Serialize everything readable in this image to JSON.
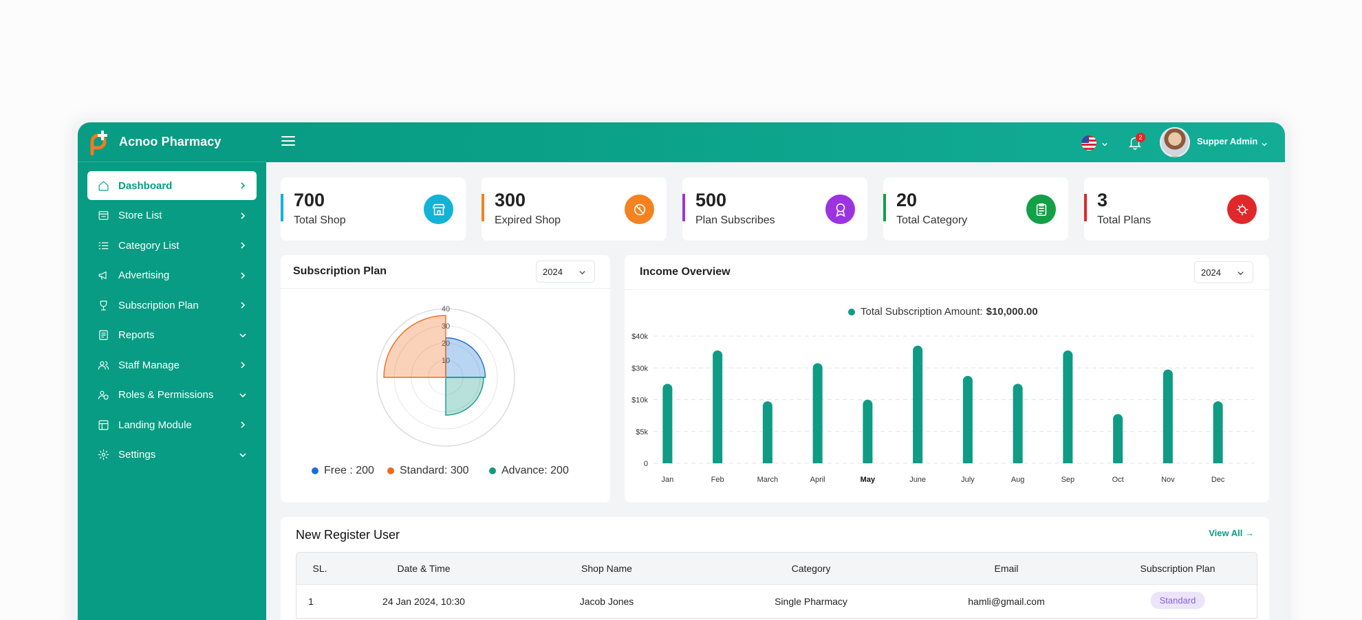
{
  "app": {
    "brand": "Acnoo Pharmacy"
  },
  "sidebar": {
    "items": [
      {
        "label": "Dashboard"
      },
      {
        "label": "Store List"
      },
      {
        "label": "Category List"
      },
      {
        "label": "Advertising"
      },
      {
        "label": "Subscription Plan"
      },
      {
        "label": "Reports"
      },
      {
        "label": "Staff Manage"
      },
      {
        "label": "Roles & Permissions"
      },
      {
        "label": "Landing Module"
      },
      {
        "label": "Settings"
      }
    ]
  },
  "topbar": {
    "notification_count": "2",
    "user_name": "Supper Admin"
  },
  "stats": [
    {
      "value": "700",
      "label": "Total Shop",
      "color": "#12b3d6"
    },
    {
      "value": "300",
      "label": "Expired Shop",
      "color": "#f58220"
    },
    {
      "value": "500",
      "label": "Plan Subscribes",
      "color": "#9b34e0"
    },
    {
      "value": "20",
      "label": "Total Category",
      "color": "#13a047"
    },
    {
      "value": "3",
      "label": "Total Plans",
      "color": "#e0282a"
    }
  ],
  "subscription_panel": {
    "title": "Subscription Plan",
    "year": "2024",
    "legend": [
      {
        "text": "Free : 200",
        "color": "#1a6fd6"
      },
      {
        "text": "Standard: 300",
        "color": "#f06a1a"
      },
      {
        "text": "Advance: 200",
        "color": "#0f9b84"
      }
    ]
  },
  "income_panel": {
    "title": "Income Overview",
    "year": "2024",
    "legend_label": "Total Subscription Amount:",
    "legend_value": "$10,000.00"
  },
  "chart_data": [
    {
      "type": "polar-area",
      "radial_ticks": [
        "10",
        "20",
        "30",
        "40"
      ],
      "rmax": 40,
      "categories": [
        "Free",
        "Standard",
        "Advance"
      ],
      "values": [
        23,
        36,
        22
      ],
      "colors": [
        "#1a6fd6",
        "#f06a1a",
        "#0f9b84"
      ]
    },
    {
      "type": "bar",
      "categories": [
        "Jan",
        "Feb",
        "March",
        "April",
        "May",
        "June",
        "July",
        "Aug",
        "Sep",
        "Oct",
        "Nov",
        "Dec"
      ],
      "ytick_labels": [
        "0",
        "$5k",
        "$10k",
        "$30k",
        "$40k"
      ],
      "values": [
        25,
        35.5,
        19.5,
        31.5,
        20,
        37,
        27.5,
        25,
        35.5,
        15.5,
        29.5,
        19.5
      ],
      "ylim": [
        0,
        40
      ],
      "grid": true,
      "bar_color": "#0f9b84"
    }
  ],
  "register": {
    "title": "New Register User",
    "view_all": "View All",
    "columns": [
      "SL.",
      "Date & Time",
      "Shop Name",
      "Category",
      "Email",
      "Subscription Plan"
    ],
    "rows": [
      {
        "sl": "1",
        "datetime": "24 Jan 2024, 10:30",
        "shop": "Jacob Jones",
        "category": "Single Pharmacy",
        "email": "hamli@gmail.com",
        "plan": "Standard"
      }
    ]
  }
}
